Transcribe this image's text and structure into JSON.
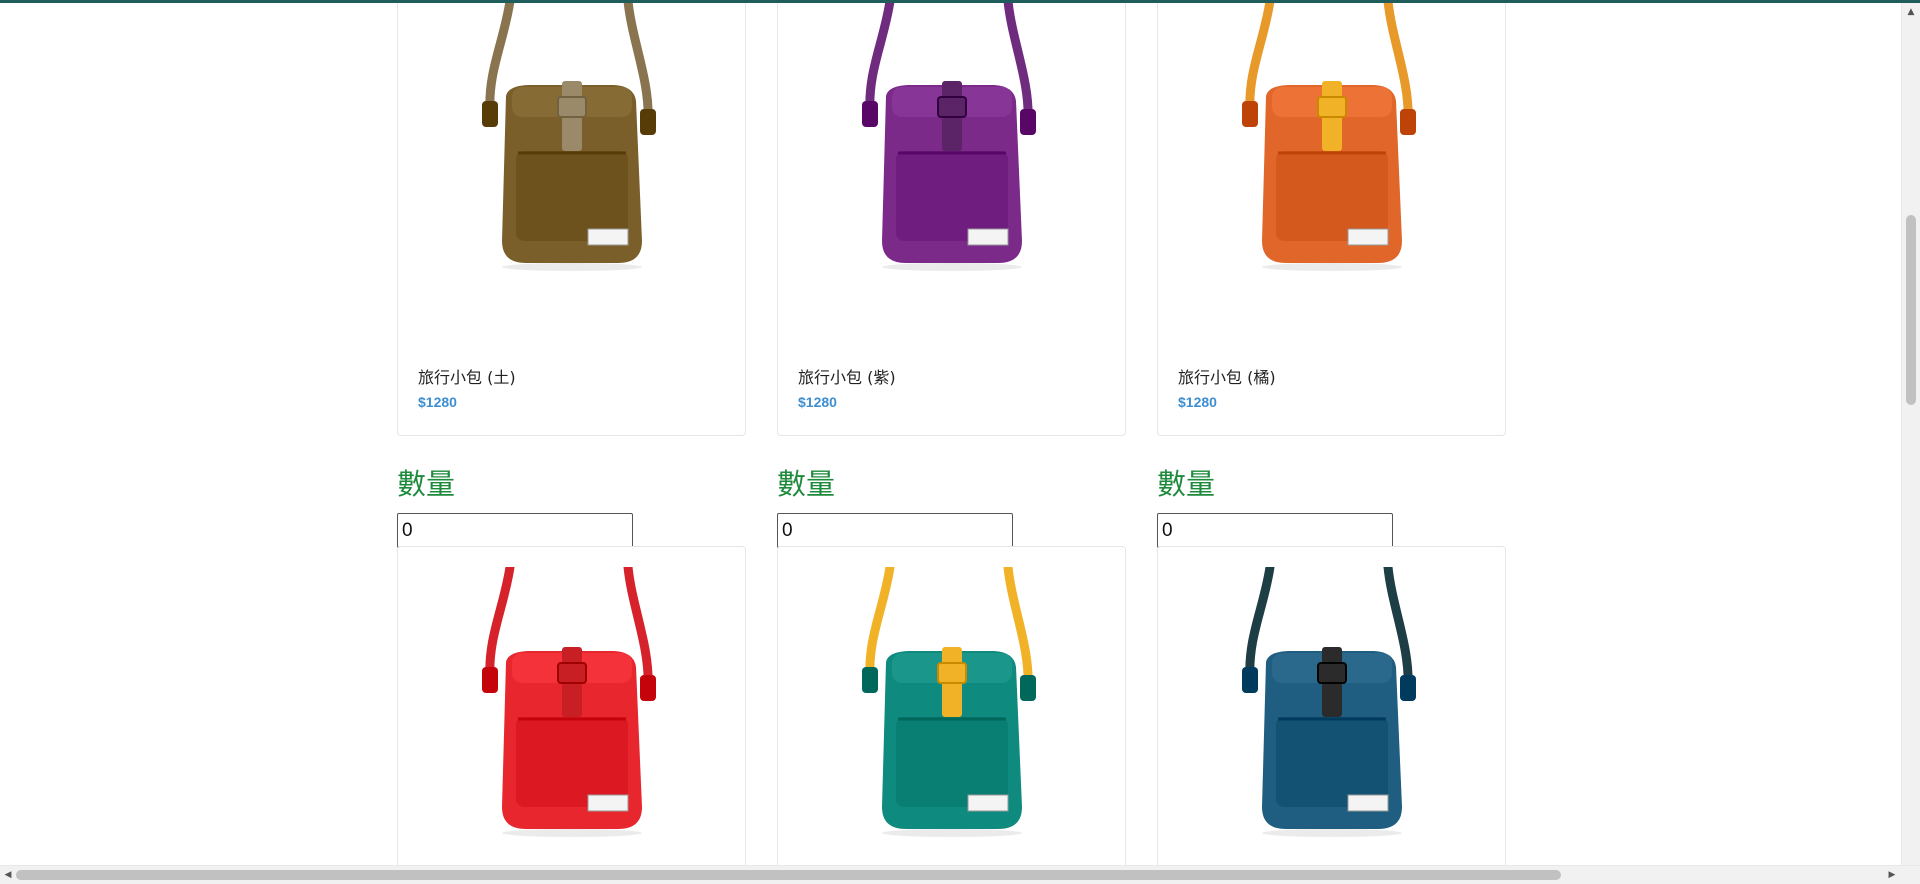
{
  "products_row1": [
    {
      "name": "旅行小包 (土)",
      "price": "$1280",
      "color": "#7a5f2a",
      "strap": "#8a7450",
      "buckle": "#9a8a6a"
    },
    {
      "name": "旅行小包 (紫)",
      "price": "$1280",
      "color": "#7b2a8a",
      "strap": "#6f2c7e",
      "buckle": "#5a2466"
    },
    {
      "name": "旅行小包 (橘)",
      "price": "$1280",
      "color": "#e0662a",
      "strap": "#e79a2a",
      "buckle": "#f2b227"
    }
  ],
  "quantity": {
    "label": "數量",
    "values": [
      "0",
      "0",
      "0"
    ]
  },
  "products_row2": [
    {
      "color": "#e8262e",
      "strap": "#d6222a",
      "buckle": "#c81f25"
    },
    {
      "color": "#0f8a7e",
      "strap": "#f2b227",
      "buckle": "#f2b227"
    },
    {
      "color": "#1f5e80",
      "strap": "#1d3e44",
      "buckle": "#2b2b2b"
    }
  ],
  "scrollbar": {
    "up_arrow": "▲",
    "down_arrow": "▼",
    "left_arrow": "◀",
    "right_arrow": "▶"
  }
}
